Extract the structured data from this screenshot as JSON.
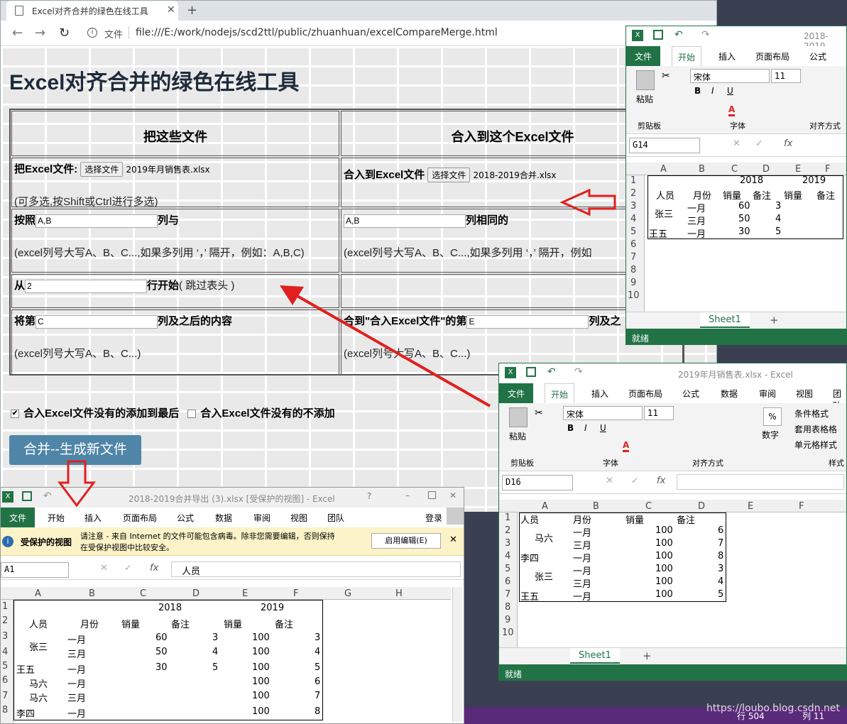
{
  "browser": {
    "tab_title": "Excel对齐合并的绿色在线工具",
    "tab_close": "✕",
    "new_tab": "+",
    "url_label": "文件",
    "url": "file:///E:/work/nodejs/scd2ttl/public/zhuanhuan/excelCompareMerge.html",
    "back": "←",
    "forward": "→",
    "reload": "↻",
    "info": "i"
  },
  "page": {
    "title": "Excel对齐合并的绿色在线工具",
    "col1_header": "把这些文件",
    "col2_header": "合入到这个Excel文件",
    "src_label": "把Excel文件:",
    "choose_btn": "选择文件",
    "src_file": "2019年月销售表.xlsx",
    "multi_note": "(可多选,按Shift或Ctrl进行多选)",
    "dst_label": "合入到Excel文件",
    "dst_file": "2018-2019合并.xlsx",
    "by_label": "按照",
    "by_value": "A,B",
    "with_label": "列与",
    "dst_cols_value": "A,B",
    "same_label": "列相同的",
    "col_note": "(excel列号大写A、B、C...,如果多列用 ‘，’ 隔开，例如：A,B,C)",
    "col_note2": "(excel列号大写A、B、C...,如果多列用 ‘，’ 隔开，例如",
    "from_label": "从",
    "from_value": "2",
    "row_start_label": "行开始",
    "skip_header": "( 跳过表头 )",
    "take_label": "将第",
    "take_value": "C",
    "after_label": "列及之后的内容",
    "col_short_note": "(excel列号大写A、B、C...)",
    "into_label": "合到\"合入Excel文件\"的第",
    "into_value": "E",
    "into_after": "列及之",
    "opt1": "合入Excel文件没有的添加到最后",
    "opt2": "合入Excel文件没有的不添加",
    "merge_button": "合并--生成新文件"
  },
  "excel_top": {
    "title_right": "2018-2019",
    "tabs": [
      "文件",
      "开始",
      "插入",
      "页面布局",
      "公式"
    ],
    "font": "宋体",
    "size": "11",
    "groups": [
      "剪贴板",
      "字体",
      "对齐方式"
    ],
    "paste": "粘贴",
    "namebox": "G14",
    "cols": [
      "A",
      "B",
      "C",
      "D",
      "E",
      "F"
    ],
    "rows": [
      "1",
      "2",
      "3",
      "4",
      "5",
      "6",
      "7",
      "8",
      "9",
      "10"
    ],
    "cells": {
      "y2018": "2018",
      "y2019": "2019",
      "person": "人员",
      "month": "月份",
      "sales": "销量",
      "remark": "备注",
      "sales2": "销量",
      "remark2": "备注",
      "zs": "张三",
      "m1": "一月",
      "m3": "三月",
      "v60": "60",
      "v3": "3",
      "v50": "50",
      "v4": "4",
      "ww": "王五",
      "m1b": "一月",
      "v30": "30",
      "v5": "5"
    },
    "sheet": "Sheet1",
    "add": "+",
    "status": "就绪"
  },
  "excel_right": {
    "title": "2019年月销售表.xlsx - Excel",
    "tabs": [
      "文件",
      "开始",
      "插入",
      "页面布局",
      "公式",
      "数据",
      "审阅",
      "视图",
      "团队"
    ],
    "font": "宋体",
    "size": "11",
    "groups": [
      "剪贴板",
      "字体",
      "对齐方式",
      "数字",
      "样式"
    ],
    "paste": "粘贴",
    "number": "数字",
    "styles": [
      "条件格式",
      "套用表格格",
      "单元格样式"
    ],
    "namebox": "D16",
    "cols": [
      "A",
      "B",
      "C",
      "D",
      "E",
      "F"
    ],
    "rows": [
      "1",
      "2",
      "3",
      "4",
      "5",
      "6",
      "7",
      "8",
      "9",
      "10"
    ],
    "header": [
      "人员",
      "月份",
      "销量",
      "备注"
    ],
    "data": [
      [
        "马六",
        "一月",
        "100",
        "6"
      ],
      [
        "",
        "三月",
        "100",
        "7"
      ],
      [
        "李四",
        "一月",
        "100",
        "8"
      ],
      [
        "张三",
        "一月",
        "100",
        "3"
      ],
      [
        "",
        "三月",
        "100",
        "4"
      ],
      [
        "王五",
        "一月",
        "100",
        "5"
      ]
    ],
    "sheet": "Sheet1",
    "add": "+",
    "status": "就绪"
  },
  "excel_bottom": {
    "title": "2018-2019合并导出 (3).xlsx  [受保护的视图] - Excel",
    "tabs": [
      "文件",
      "开始",
      "插入",
      "页面布局",
      "公式",
      "数据",
      "审阅",
      "视图",
      "团队"
    ],
    "login": "登录",
    "protect_title": "受保护的视图",
    "protect_msg1": "请注意 - 来自 Internet 的文件可能包含病毒。除非您需要编辑，否则保持",
    "protect_msg2": "在受保护视图中比较安全。",
    "enable_edit": "启用编辑(E)",
    "namebox": "A1",
    "formula": "人员",
    "cols": [
      "A",
      "B",
      "C",
      "D",
      "E",
      "F",
      "G",
      "H"
    ],
    "rows": [
      "1",
      "2",
      "3",
      "4",
      "5",
      "6",
      "7",
      "8"
    ],
    "c": {
      "y2018": "2018",
      "y2019": "2019",
      "person": "人员",
      "month": "月份",
      "s1": "销量",
      "r1": "备注",
      "s2": "销量",
      "r2": "备注",
      "zs": "张三",
      "m1": "一月",
      "m3": "三月",
      "v60": "60",
      "v3": "3",
      "v100a": "100",
      "v3b": "3",
      "v50": "50",
      "v4": "4",
      "v100b": "100",
      "v4b": "4",
      "ww": "王五",
      "m1c": "一月",
      "v30": "30",
      "v5": "5",
      "v100c": "100",
      "v5b": "5",
      "ml": "马六",
      "m1d": "一月",
      "v100d": "100",
      "v6": "6",
      "ml2": "马六",
      "m3b": "三月",
      "v100e": "100",
      "v7": "7",
      "ls": "李四",
      "m1e": "一月",
      "v100f": "100",
      "v8": "8"
    }
  },
  "bottom_status": {
    "row": "行 504",
    "col": "列 11"
  },
  "watermark": "https://loubo.blog.csdn.net",
  "colors": {
    "excel_green": "#217346",
    "arrow_red": "#e02020",
    "button_blue": "#4f86a8"
  }
}
